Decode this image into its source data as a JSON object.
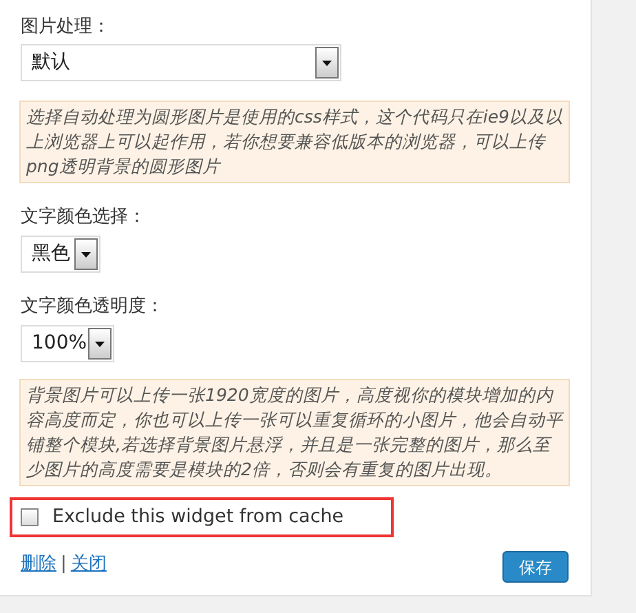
{
  "image_processing": {
    "label": "图片处理：",
    "value": "默认",
    "notice": "选择自动处理为圆形图片是使用的css样式，这个代码只在ie9以及以上浏览器上可以起作用，若你想要兼容低版本的浏览器，可以上传png透明背景的圆形图片"
  },
  "text_color": {
    "label": "文字颜色选择：",
    "value": "黑色"
  },
  "text_opacity": {
    "label": "文字颜色透明度：",
    "value": "100%"
  },
  "background_notice": "背景图片可以上传一张1920宽度的图片，高度视你的模块增加的内容高度而定，你也可以上传一张可以重复循环的小图片，他会自动平铺整个模块,若选择背景图片悬浮，并且是一张完整的图片，那么至少图片的高度需要是模块的2倍，否则会有重复的图片出现。",
  "cache_option": {
    "label": "Exclude this widget from cache",
    "checked": false
  },
  "links": [
    {
      "label": "删除"
    },
    {
      "label": "关闭"
    }
  ],
  "link_separator": "|",
  "save_button": "保存"
}
